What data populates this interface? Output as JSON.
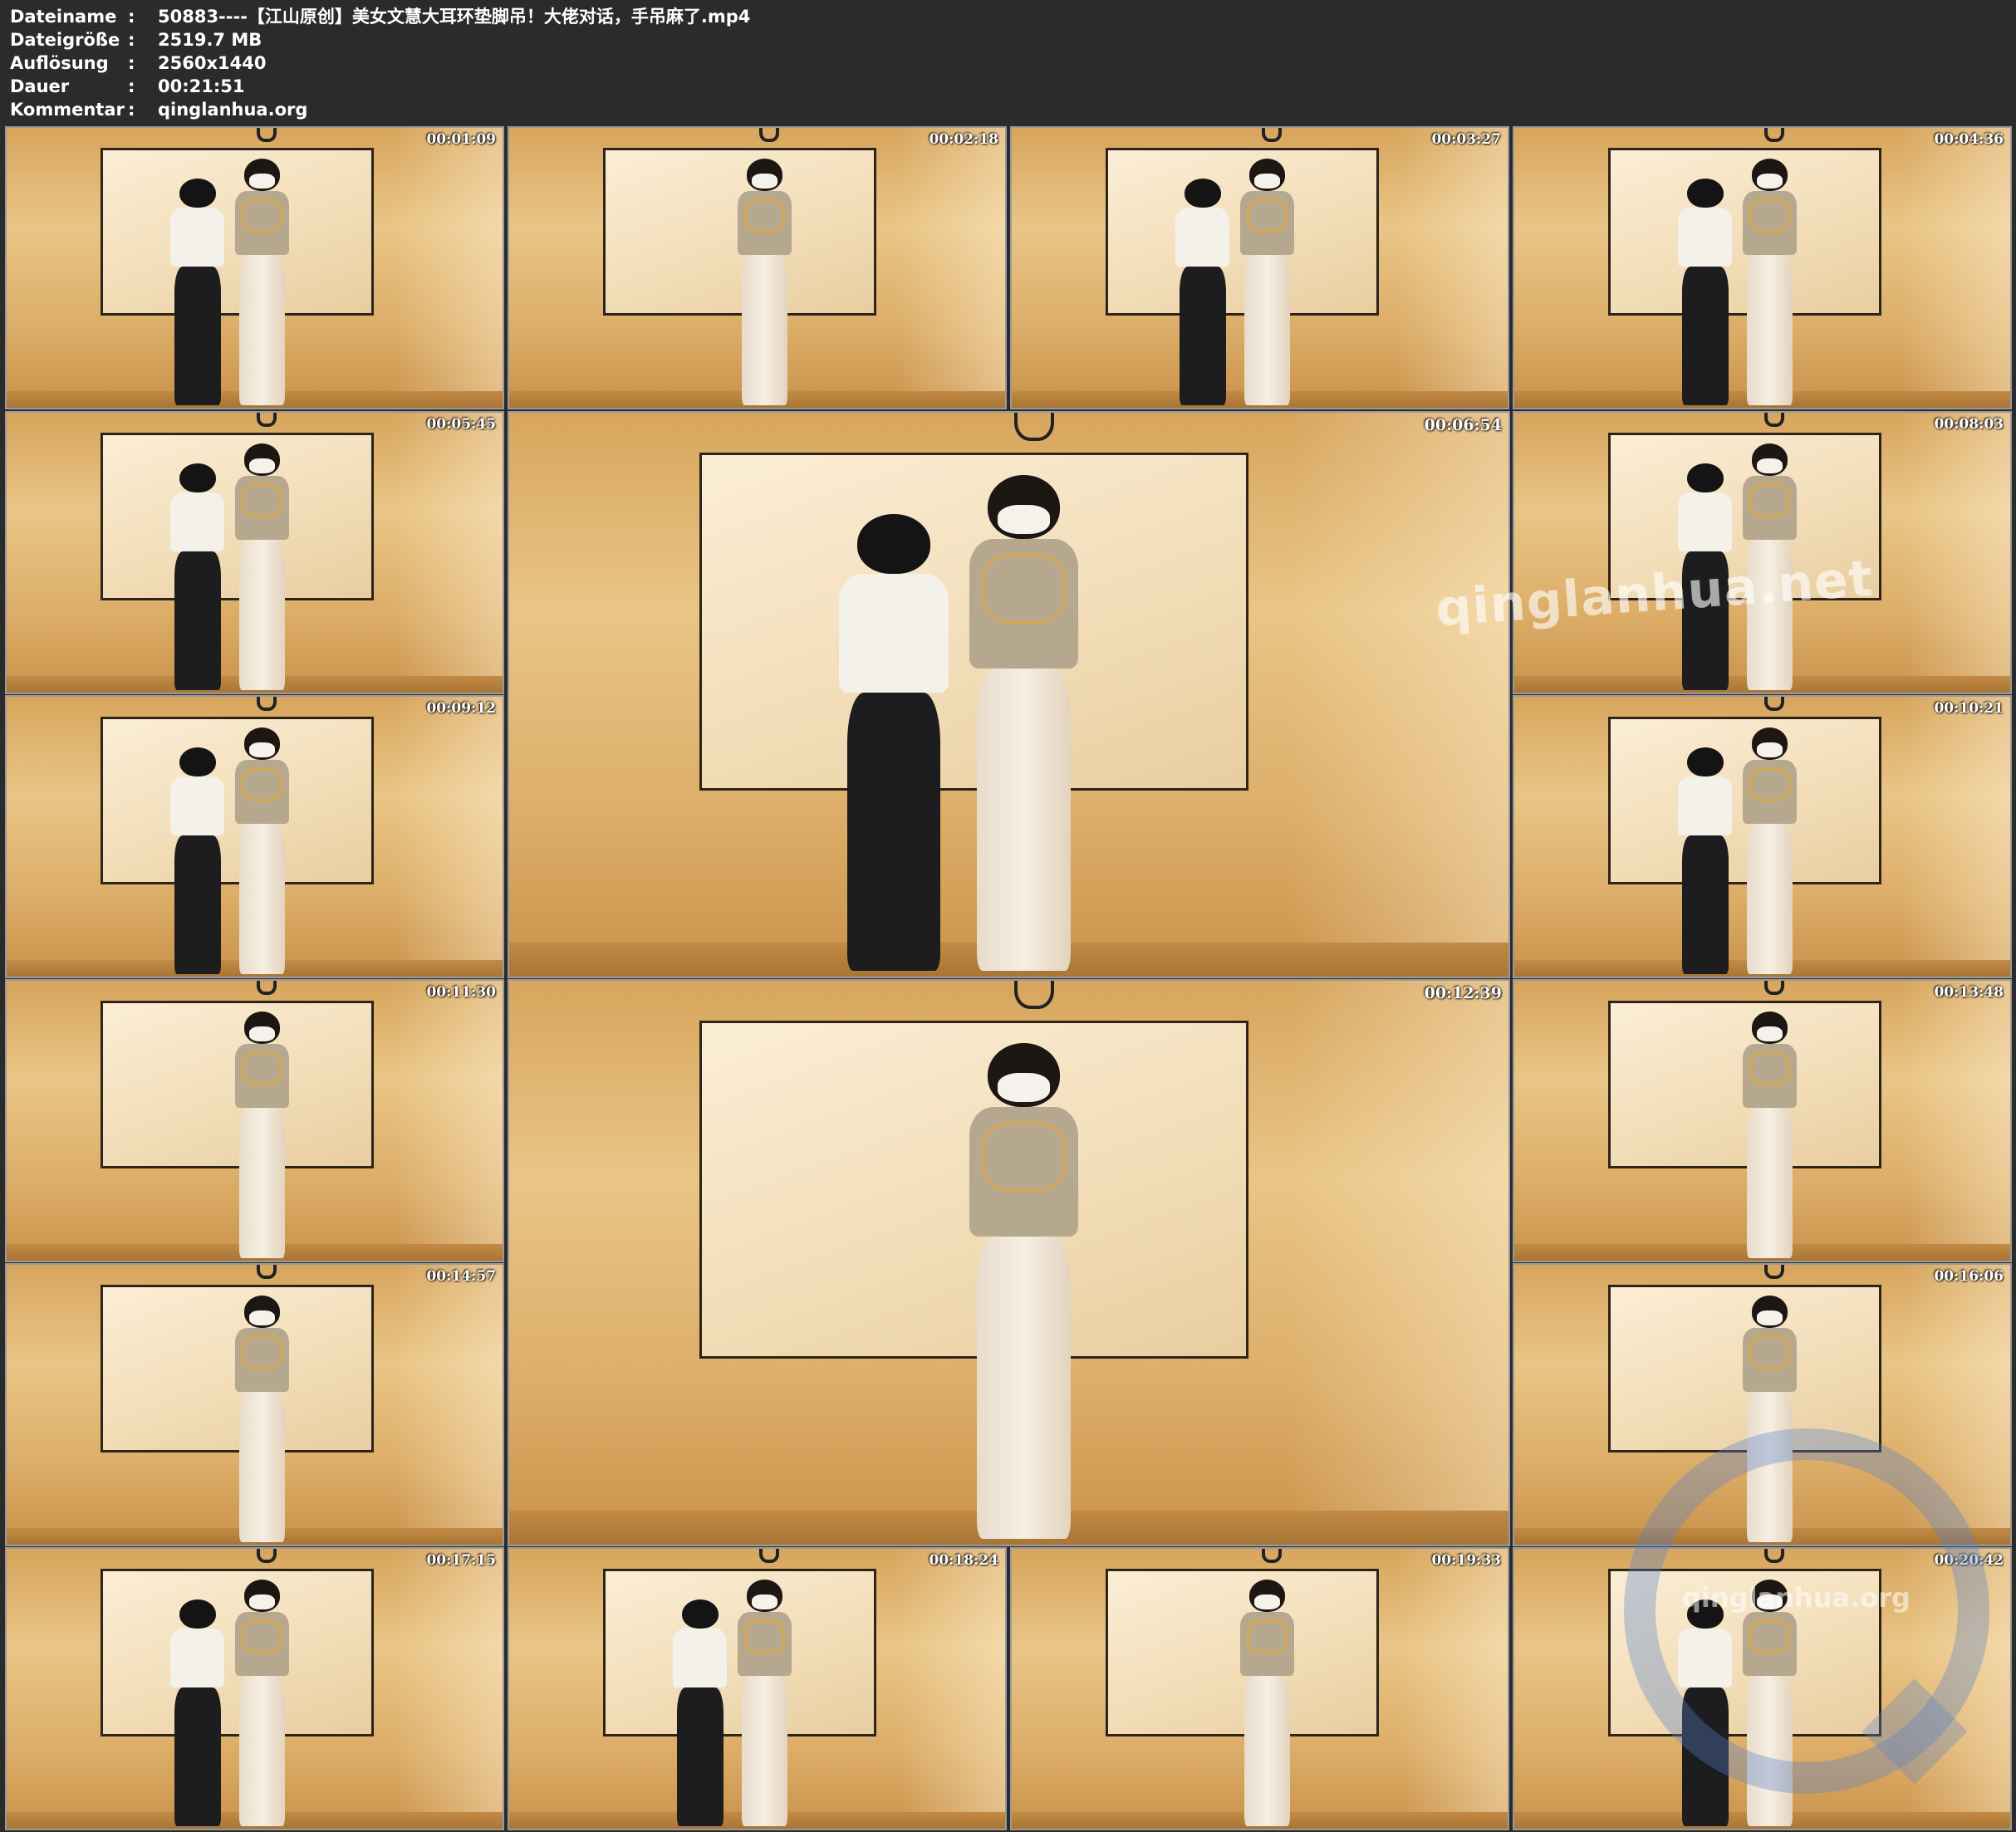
{
  "info": {
    "rows": [
      {
        "key": "Dateiname",
        "sep": ":",
        "value": "50883----【江山原创】美女文慧大耳环垫脚吊！大佬对话，手吊麻了.mp4"
      },
      {
        "key": "Dateigröße",
        "sep": ":",
        "value": "2519.7 MB"
      },
      {
        "key": "Auflösung",
        "sep": ":",
        "value": "2560x1440"
      },
      {
        "key": "Dauer",
        "sep": ":",
        "value": "00:21:51"
      },
      {
        "key": "Kommentar",
        "sep": ":",
        "value": "qinglanhua.org"
      }
    ]
  },
  "thumbnails": [
    {
      "time": "00:01:09",
      "man": true
    },
    {
      "time": "00:02:18",
      "man": false
    },
    {
      "time": "00:03:27",
      "man": true
    },
    {
      "time": "00:04:36",
      "man": true
    },
    {
      "time": "00:05:45",
      "man": true
    },
    {
      "time": "00:06:54",
      "man": true
    },
    {
      "time": "00:08:03",
      "man": true
    },
    {
      "time": "00:09:12",
      "man": true
    },
    {
      "time": "00:10:21",
      "man": true
    },
    {
      "time": "00:11:30",
      "man": false
    },
    {
      "time": "00:12:39",
      "man": false
    },
    {
      "time": "00:13:48",
      "man": false
    },
    {
      "time": "00:14:57",
      "man": false
    },
    {
      "time": "00:16:06",
      "man": false
    },
    {
      "time": "00:17:15",
      "man": true
    },
    {
      "time": "00:18:24",
      "man": true
    },
    {
      "time": "00:19:33",
      "man": false
    },
    {
      "time": "00:20:42",
      "man": true
    }
  ],
  "watermarks": {
    "center_text": "qinglanhua.net",
    "corner_text": "qinglanhua.org"
  },
  "colors": {
    "background": "#2b2b2b",
    "info_text": "#ffffff",
    "tile_border": "#9a9a9a"
  }
}
